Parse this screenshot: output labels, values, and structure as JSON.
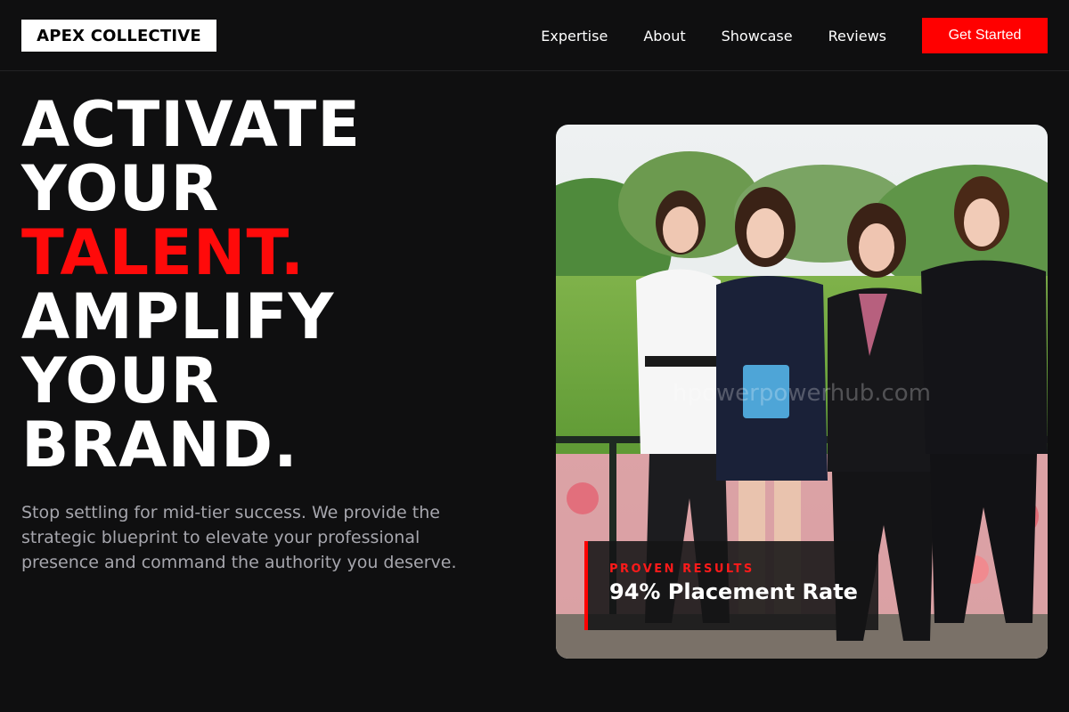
{
  "header": {
    "logo": "APEX COLLECTIVE",
    "nav": [
      "Expertise",
      "About",
      "Showcase",
      "Reviews"
    ],
    "cta": "Get Started"
  },
  "hero": {
    "title_lines": [
      "ACTIVATE",
      "YOUR",
      "TALENT.",
      "AMPLIFY",
      "YOUR",
      "BRAND."
    ],
    "description": "Stop settling for mid-tier success. We provide the strategic blueprint to elevate your professional presence and command the authority you deserve."
  },
  "photo": {
    "watermark": "hpowerpowerhub.com",
    "badge": {
      "kicker": "PROVEN RESULTS",
      "value": "94% Placement Rate"
    }
  },
  "colors": {
    "accent": "#ff0000",
    "background": "#0f0f10",
    "muted_text": "#a6a6ad"
  }
}
